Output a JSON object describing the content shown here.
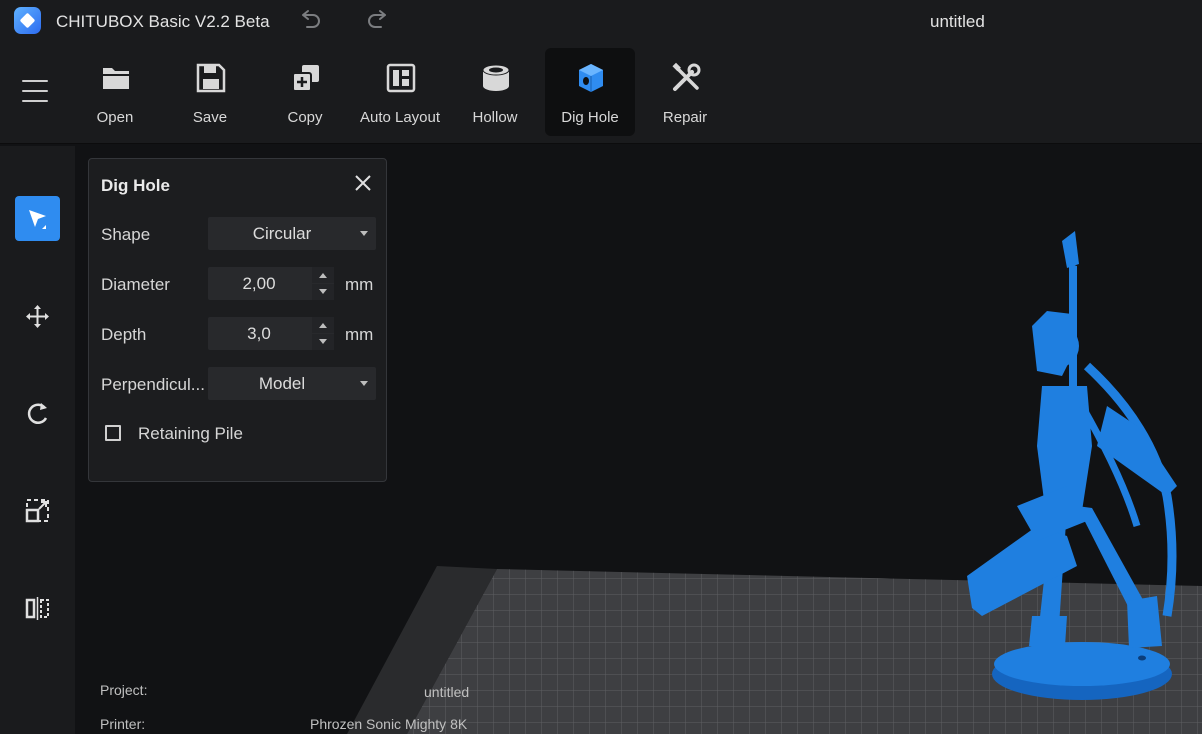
{
  "titlebar": {
    "app_name": "CHITUBOX Basic V2.2 Beta",
    "document": "untitled"
  },
  "toolbar": {
    "items": [
      {
        "label": "Open",
        "icon": "folder-icon"
      },
      {
        "label": "Save",
        "icon": "floppy-disk-icon"
      },
      {
        "label": "Copy",
        "icon": "copy-icon"
      },
      {
        "label": "Auto Layout",
        "icon": "layout-icon"
      },
      {
        "label": "Hollow",
        "icon": "hollow-cylinder-icon"
      },
      {
        "label": "Dig Hole",
        "icon": "dig-hole-cube-icon",
        "active": true
      },
      {
        "label": "Repair",
        "icon": "wrench-screwdriver-icon"
      }
    ]
  },
  "sidebar": {
    "tools": [
      "select-cursor-icon",
      "move-arrows-icon",
      "rotate-icon",
      "scale-icon",
      "mirror-icon"
    ],
    "active": "select-cursor-icon"
  },
  "dig_hole_panel": {
    "title": "Dig Hole",
    "shape": {
      "label": "Shape",
      "value": "Circular"
    },
    "diameter": {
      "label": "Diameter",
      "value": "2,00",
      "unit": "mm"
    },
    "depth": {
      "label": "Depth",
      "value": "3,0",
      "unit": "mm"
    },
    "perpendicular": {
      "label": "Perpendicul...",
      "value": "Model"
    },
    "retaining_pile": {
      "label": "Retaining Pile",
      "checked": false
    }
  },
  "info": {
    "project_label": "Project:",
    "project_value": "untitled",
    "printer_label": "Printer:",
    "printer_value": "Phrozen Sonic Mighty 8K"
  },
  "colors": {
    "accent": "#2f8cf0",
    "model": "#1f7fe0",
    "background": "#111214",
    "panel": "#1c1d1f"
  }
}
